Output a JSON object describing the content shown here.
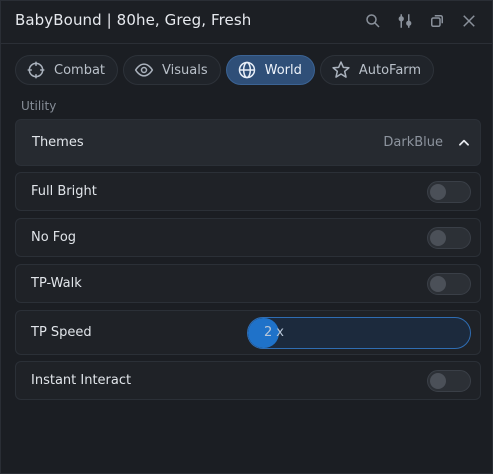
{
  "window": {
    "title": "BabyBound | 80he, Greg, Fresh",
    "icons": [
      "search-icon",
      "sliders-icon",
      "copy-icon",
      "close-icon"
    ]
  },
  "tabs": [
    {
      "label": "Combat",
      "icon": "crosshair-icon",
      "active": false
    },
    {
      "label": "Visuals",
      "icon": "eye-icon",
      "active": false
    },
    {
      "label": "World",
      "icon": "globe-icon",
      "active": true
    },
    {
      "label": "AutoFarm",
      "icon": "star-icon",
      "active": false
    }
  ],
  "section": {
    "label": "Utility"
  },
  "themes": {
    "label": "Themes",
    "value": "DarkBlue"
  },
  "toggles": [
    {
      "label": "Full Bright",
      "on": false
    },
    {
      "label": "No Fog",
      "on": false
    },
    {
      "label": "TP-Walk",
      "on": false
    }
  ],
  "tp_speed": {
    "label": "TP Speed",
    "value": "2",
    "unit": "x",
    "fraction": 0.14
  },
  "instant_interact": {
    "label": "Instant Interact",
    "on": false
  },
  "colors": {
    "accent": "#2f6db3",
    "active_tab": "#2f4f78",
    "background": "#1b1e23"
  }
}
